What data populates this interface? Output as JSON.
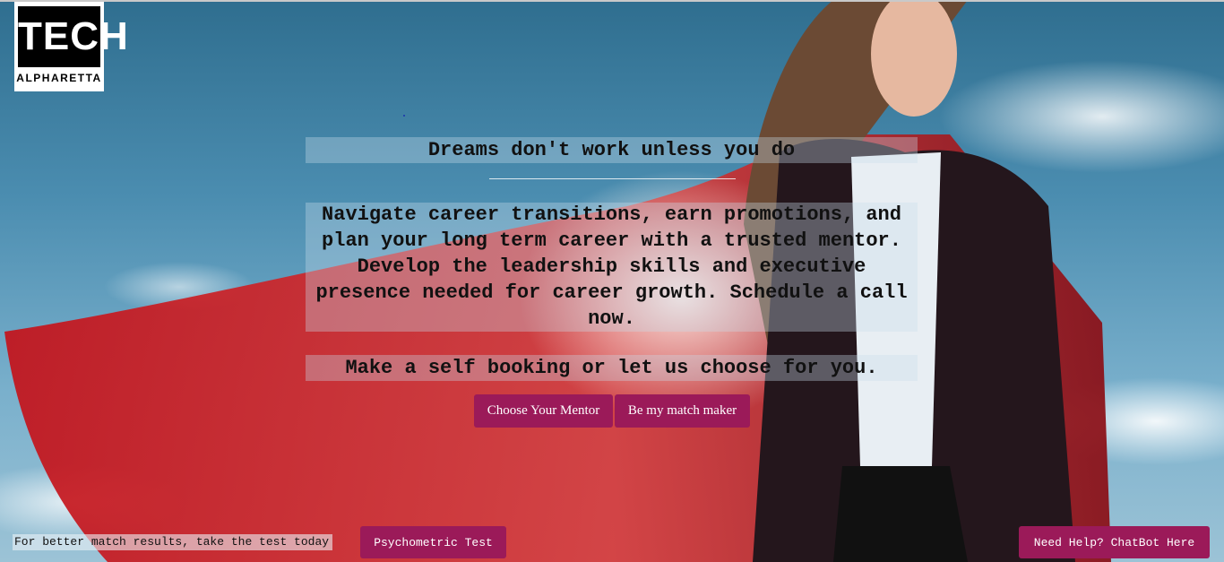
{
  "logo": {
    "title": "TECH",
    "subtitle": "ALPHARETTA"
  },
  "hero": {
    "headline": "Dreams don't work unless you do",
    "body": "Navigate career transitions, earn promotions, and plan your long term career with a trusted mentor. Develop the leadership skills and executive presence needed for career growth. Schedule a call now.",
    "cta_text": "Make a self booking or let us choose for you."
  },
  "buttons": {
    "choose_mentor": "Choose Your Mentor",
    "match_maker": "Be my match maker"
  },
  "footer": {
    "note": "For better match results, take the test today",
    "psychometric": "Psychometric Test",
    "chatbot": "Need Help? ChatBot Here"
  },
  "colors": {
    "accent": "#9b1a59",
    "sky": "#4b8db0"
  }
}
